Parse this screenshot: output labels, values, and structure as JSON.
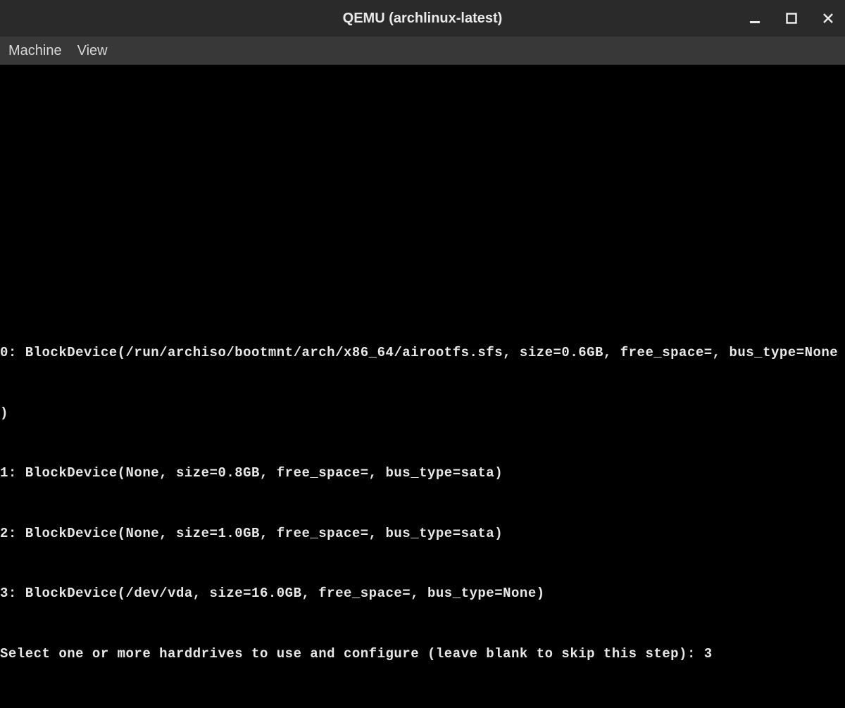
{
  "window": {
    "title": "QEMU (archlinux-latest)"
  },
  "menubar": {
    "items": [
      "Machine",
      "View"
    ]
  },
  "terminal": {
    "lines": [
      "0: BlockDevice(/run/archiso/bootmnt/arch/x86_64/airootfs.sfs, size=0.6GB, free_space=, bus_type=None",
      ")",
      "1: BlockDevice(None, size=0.8GB, free_space=, bus_type=sata)",
      "2: BlockDevice(None, size=1.0GB, free_space=, bus_type=sata)",
      "3: BlockDevice(/dev/vda, size=16.0GB, free_space=, bus_type=None)"
    ],
    "prompt": "Select one or more harddrives to use and configure (leave blank to skip this step): ",
    "input_value": "3"
  }
}
